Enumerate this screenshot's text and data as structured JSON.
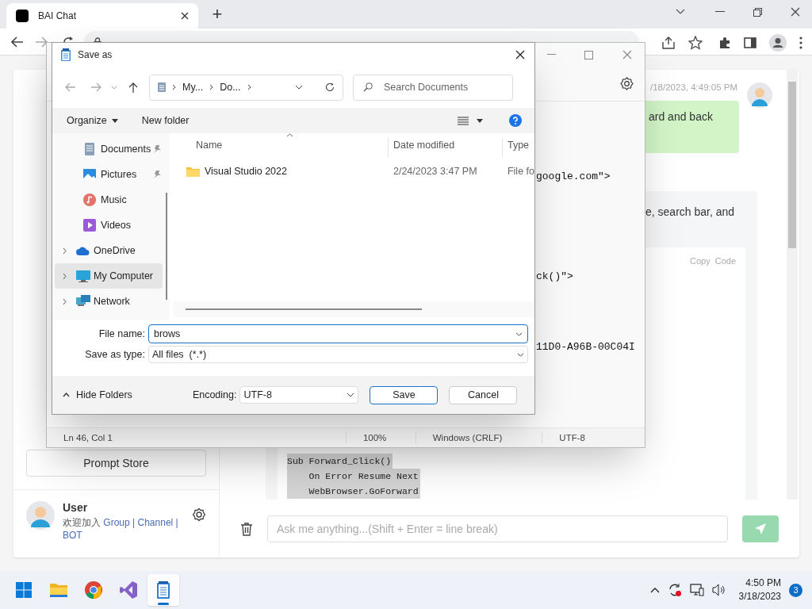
{
  "browser": {
    "tab_title": "BAI Chat",
    "new_tab": "+"
  },
  "chat": {
    "sidebar": {
      "prompt_store": "Prompt Store",
      "user": {
        "name": "User",
        "welcome": "欢迎加入",
        "links": [
          "Group",
          "Channel",
          "BOT"
        ],
        "link_separator": "|"
      }
    },
    "messages": [
      {
        "kind": "user",
        "time": "/18/2023, 4:49:05 PM",
        "text": "ard and back"
      },
      {
        "kind": "bot",
        "text": "e, search bar, and",
        "code_actions": [
          "Copy",
          "Code"
        ],
        "code": [
          "Sub Forward_Click()",
          "    On Error Resume Next",
          "    WebBrowser.GoForward"
        ]
      }
    ],
    "input": {
      "placeholder": "Ask me anything...(Shift + Enter = line break)"
    }
  },
  "notepad": {
    "lines": [
      "google.com\">",
      "ck()\">",
      "11D0-A96B-00C04I"
    ],
    "status_bar": [
      "Ln 46, Col 1",
      "100%",
      "Windows (CRLF)",
      "UTF-8"
    ]
  },
  "save_dialog": {
    "title": "Save as",
    "breadcrumb": [
      "My...",
      "Do..."
    ],
    "search_placeholder": "Search Documents",
    "commands": [
      "Organize",
      "New folder"
    ],
    "nav_items": [
      {
        "label": "Documents",
        "kind": "documents",
        "pinned": true,
        "expandable": false,
        "selected": false
      },
      {
        "label": "Pictures",
        "kind": "pictures",
        "pinned": true,
        "expandable": false,
        "selected": false
      },
      {
        "label": "Music",
        "kind": "music",
        "pinned": false,
        "expandable": false,
        "selected": false
      },
      {
        "label": "Videos",
        "kind": "videos",
        "pinned": false,
        "expandable": false,
        "selected": false
      },
      {
        "label": "OneDrive",
        "kind": "cloud",
        "pinned": false,
        "expandable": true,
        "selected": false
      },
      {
        "label": "My Computer",
        "kind": "computer",
        "pinned": false,
        "expandable": true,
        "selected": true
      },
      {
        "label": "Network",
        "kind": "network",
        "pinned": false,
        "expandable": true,
        "selected": false
      }
    ],
    "columns": [
      "Name",
      "Date modified",
      "Type"
    ],
    "rows": [
      {
        "name": "Visual Studio 2022",
        "date_modified": "2/24/2023 3:47 PM",
        "type": "File fo"
      }
    ],
    "file_name_label": "File name:",
    "file_name": "brows",
    "save_type_label": "Save as type:",
    "save_type": "All files  (*.*)",
    "hide_folders": "Hide Folders",
    "encoding_label": "Encoding:",
    "encoding": "UTF-8",
    "buttons": [
      "Save",
      "Cancel"
    ]
  },
  "taskbar": {
    "apps": [
      {
        "kind": "start",
        "selected": false
      },
      {
        "kind": "explorer",
        "selected": false
      },
      {
        "kind": "browser",
        "selected": false
      },
      {
        "kind": "studio",
        "selected": false
      },
      {
        "kind": "notepad",
        "selected": true
      }
    ],
    "time": "4:50 PM",
    "date": "3/18/2023",
    "badge": "3"
  }
}
